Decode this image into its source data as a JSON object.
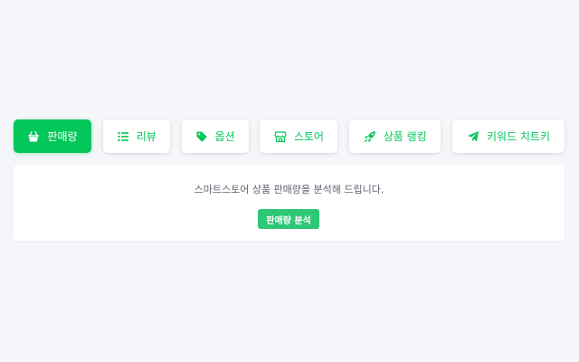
{
  "tabs": [
    {
      "label": "판매량",
      "icon": "basket-icon",
      "active": true
    },
    {
      "label": "리뷰",
      "icon": "list-icon",
      "active": false
    },
    {
      "label": "옵션",
      "icon": "tag-icon",
      "active": false
    },
    {
      "label": "스토어",
      "icon": "store-icon",
      "active": false
    },
    {
      "label": "상품 랭킹",
      "icon": "rocket-icon",
      "active": false
    },
    {
      "label": "키워드 치트키",
      "icon": "paper-plane-icon",
      "active": false
    }
  ],
  "panel": {
    "description": "스마트스토어 상품 판매량을 분석해 드립니다.",
    "button_label": "판매량 분석"
  },
  "colors": {
    "accent": "#03c75a",
    "button": "#2ec776",
    "background": "#f5f6fa",
    "text_muted": "#5f6470"
  }
}
